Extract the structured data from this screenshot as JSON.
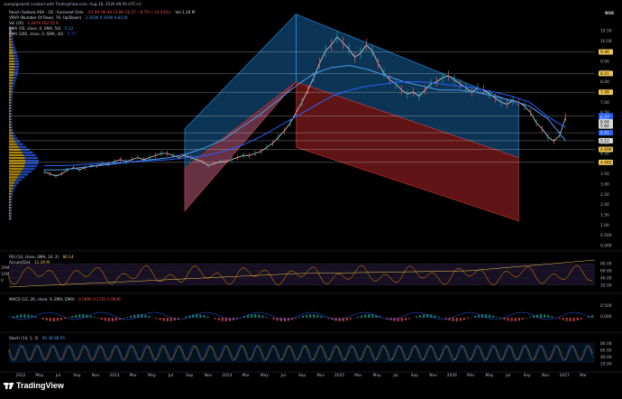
{
  "watermark_line": "savepigewest created with TradingView.com, Aug 18, 2026 09:56 UTC+2",
  "symbol_line": "Reach Subsea ASA · 1D · Euronext Oslo",
  "ohlc": "O1.90 H6.40 L5.86 C6.27 −0.79 (−14.42%)",
  "vol_line": "Vol 1.28 M",
  "ind_vrvp": "VRVP (Number Of Rows, 70, Up/Down)",
  "ind_vrvp_vals": "2.303K  4.264K  6.811K",
  "ind_vol": "Vol (20)",
  "ind_vol_vals": "1.28 M  262.55 K",
  "ind_sma50": "SMA (50, close, 0, SMA, 50)",
  "ind_sma50_val": "5.12",
  "ind_sma200": "SMA (200, close, 0, SMA, 20)",
  "ind_sma200_val": "5.77",
  "currency": "NOK",
  "brand": "TradingView",
  "chart_data": {
    "type": "line",
    "price_axis": [
      "10.50",
      "10.00",
      "9.50",
      "9.00",
      "8.50",
      "8.00",
      "7.50",
      "7.00",
      "6.50",
      "6.00",
      "5.50",
      "5.00",
      "4.50",
      "4.00",
      "3.50",
      "3.00",
      "2.50",
      "2.00",
      "1.50",
      "1.00",
      "0.500",
      "0.000"
    ],
    "price_labels": [
      {
        "text": "9.46",
        "price": 9.46,
        "color": "#f0c850",
        "fg": "#000"
      },
      {
        "text": "8.41",
        "price": 8.41,
        "color": "#f0c850",
        "fg": "#000"
      },
      {
        "text": "7.49",
        "price": 7.49,
        "color": "#f0c850",
        "fg": "#000"
      },
      {
        "text": "6.34",
        "price": 6.34,
        "color": "#2962ff",
        "fg": "#fff"
      },
      {
        "text": "6.27",
        "price": 6.27,
        "color": "#2962ff",
        "fg": "#fff"
      },
      {
        "text": "6.04",
        "price": 6.04,
        "color": "#d8d8d8",
        "fg": "#000"
      },
      {
        "text": "5.84",
        "price": 5.84,
        "color": "#d8d8d8",
        "fg": "#000"
      },
      {
        "text": "5.51",
        "price": 5.51,
        "color": "#2962ff",
        "fg": "#fff"
      },
      {
        "text": "5.12",
        "price": 5.12,
        "color": "#d8d8d8",
        "fg": "#000"
      },
      {
        "text": "4.699",
        "price": 4.699,
        "color": "#f0c850",
        "fg": "#000"
      },
      {
        "text": "4.065",
        "price": 4.065,
        "color": "#f0c850",
        "fg": "#000"
      }
    ],
    "horizontal_levels": [
      9.46,
      8.41,
      7.49,
      6.34,
      5.51,
      5.12,
      4.699,
      4.065
    ],
    "x_axis": [
      "2022",
      "May",
      "Jul",
      "Sep",
      "Nov",
      "2023",
      "Mar",
      "May",
      "Jul",
      "Sep",
      "Nov",
      "2024",
      "Mar",
      "May",
      "Jul",
      "Sep",
      "Nov",
      "2025",
      "Mar",
      "May",
      "Jul",
      "Sep",
      "Nov",
      "2026",
      "Mar",
      "May",
      "Jul",
      "Sep",
      "Nov",
      "2027",
      "Mar"
    ],
    "price_series": [
      3.6,
      3.5,
      3.4,
      3.5,
      3.7,
      3.8,
      3.7,
      3.8,
      3.9,
      3.9,
      4.0,
      4.0,
      4.1,
      4.2,
      4.1,
      4.2,
      4.3,
      4.2,
      4.3,
      4.4,
      4.5,
      4.5,
      4.4,
      4.3,
      4.4,
      4.3,
      4.2,
      4.1,
      3.9,
      4.0,
      4.1,
      4.1,
      4.2,
      4.3,
      4.4,
      4.4,
      4.5,
      4.6,
      4.8,
      5.0,
      5.3,
      5.6,
      6.0,
      6.5,
      7.0,
      7.6,
      8.2,
      8.9,
      9.5,
      9.8,
      10.2,
      9.9,
      9.6,
      9.2,
      9.4,
      9.8,
      9.5,
      8.9,
      8.4,
      8.1,
      7.9,
      7.6,
      7.4,
      7.5,
      7.3,
      7.6,
      7.9,
      8.0,
      8.2,
      8.3,
      8.1,
      7.9,
      7.7,
      7.5,
      7.7,
      7.6,
      7.4,
      7.2,
      7.0,
      6.9,
      7.1,
      7.0,
      6.8,
      6.5,
      6.0,
      5.7,
      5.3,
      5.1,
      5.4,
      6.27
    ],
    "sma_50": [
      3.7,
      3.7,
      3.8,
      3.9,
      4.0,
      4.1,
      4.2,
      4.3,
      4.5,
      4.8,
      5.2,
      5.8,
      6.4,
      7.1,
      7.8,
      8.4,
      8.7,
      8.8,
      8.6,
      8.3,
      8.0,
      7.8,
      7.6,
      7.6,
      7.5,
      7.3,
      7.1,
      6.8,
      6.2,
      5.12
    ],
    "sma_200": [
      3.9,
      3.9,
      3.95,
      4.0,
      4.05,
      4.1,
      4.15,
      4.2,
      4.3,
      4.4,
      4.6,
      4.9,
      5.3,
      5.8,
      6.3,
      6.8,
      7.3,
      7.6,
      7.8,
      7.9,
      8.0,
      8.0,
      7.9,
      7.8,
      7.7,
      7.5,
      7.3,
      7.0,
      6.3,
      5.77
    ],
    "channels": [
      {
        "name": "ascending",
        "color": "#2196f3",
        "fill": "rgba(33,150,243,0.35)",
        "from": [
          0.3,
          1.7,
          5.7
        ],
        "to": [
          0.49,
          8.0,
          11.3
        ]
      },
      {
        "name": "ascending-lower",
        "color": "#d32f2f",
        "fill": "rgba(211,47,47,0.45)",
        "from": [
          0.3,
          1.7,
          3.8
        ],
        "to": [
          0.49,
          8.0,
          8.0
        ]
      },
      {
        "name": "descending",
        "color": "#2196f3",
        "fill": "rgba(33,150,243,0.35)",
        "from": [
          0.49,
          8.0,
          11.3
        ],
        "to": [
          0.87,
          4.3,
          6.9
        ]
      },
      {
        "name": "descending-lower",
        "color": "#d32f2f",
        "fill": "rgba(211,47,47,0.45)",
        "from": [
          0.49,
          4.8,
          8.0
        ],
        "to": [
          0.87,
          1.2,
          4.3
        ]
      }
    ],
    "rsi": {
      "label": "RSI (14, close, SMA, 14, 2)",
      "value": "80.14",
      "sub_label": "Accum/Dist",
      "sub_value": "11.39 M",
      "axis": [
        "80.00",
        "60.00",
        "40.00",
        "20.00"
      ],
      "left_axis": [
        "20M",
        "10M",
        "0"
      ]
    },
    "macd": {
      "label": "MACD (12, 26, close, 9, EMA, EMA)",
      "vals": "0.0895  0.1751  0.0839",
      "axis": [
        "0.500",
        "0.000"
      ]
    },
    "stoch": {
      "label": "Stoch (14, 1, 3)",
      "vals": "90.38  88.95",
      "axis": [
        "80.00",
        "60.00",
        "40.00",
        "20.00"
      ]
    }
  }
}
